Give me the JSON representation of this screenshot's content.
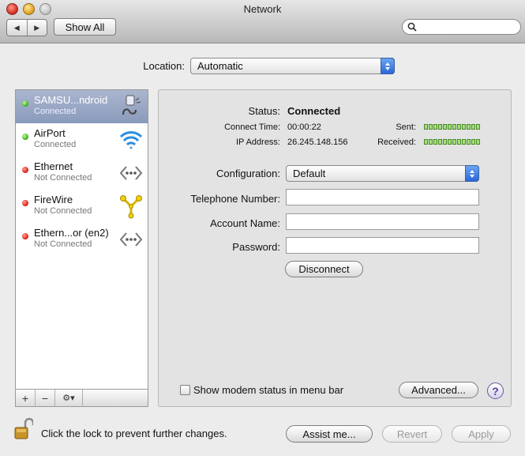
{
  "window": {
    "title": "Network"
  },
  "toolbar": {
    "back_label": "◀",
    "forward_label": "▶",
    "show_all_label": "Show All",
    "search_placeholder": ""
  },
  "location": {
    "label": "Location:",
    "value": "Automatic"
  },
  "services": [
    {
      "name": "SAMSU...ndroid",
      "status": "Connected",
      "status_color": "green",
      "icon": "phone-modem-icon",
      "selected": true
    },
    {
      "name": "AirPort",
      "status": "Connected",
      "status_color": "green",
      "icon": "wifi-icon",
      "selected": false
    },
    {
      "name": "Ethernet",
      "status": "Not Connected",
      "status_color": "red",
      "icon": "ethernet-icon",
      "selected": false
    },
    {
      "name": "FireWire",
      "status": "Not Connected",
      "status_color": "red",
      "icon": "firewire-icon",
      "selected": false
    },
    {
      "name": "Ethern...or (en2)",
      "status": "Not Connected",
      "status_color": "red",
      "icon": "ethernet-icon",
      "selected": false
    }
  ],
  "sidebar_toolbar": {
    "add_label": "+",
    "remove_label": "−",
    "action_label": "⚙▾"
  },
  "detail": {
    "status_label": "Status:",
    "status_value": "Connected",
    "connect_time_label": "Connect Time:",
    "connect_time_value": "00:00:22",
    "ip_label": "IP Address:",
    "ip_value": "26.245.148.156",
    "sent_label": "Sent:",
    "received_label": "Received:",
    "configuration_label": "Configuration:",
    "configuration_value": "Default",
    "telephone_label": "Telephone Number:",
    "telephone_value": "",
    "account_label": "Account Name:",
    "account_value": "",
    "password_label": "Password:",
    "password_value": "",
    "disconnect_label": "Disconnect",
    "show_modem_label": "Show modem status in menu bar",
    "advanced_label": "Advanced...",
    "help_label": "?"
  },
  "footer": {
    "lock_text": "Click the lock to prevent further changes.",
    "assist_label": "Assist me...",
    "revert_label": "Revert",
    "apply_label": "Apply"
  },
  "colors": {
    "selection": "#8a9abb",
    "status_green": "#3cb31c",
    "status_red": "#e0221a",
    "popup_blue": "#2b68d8"
  }
}
